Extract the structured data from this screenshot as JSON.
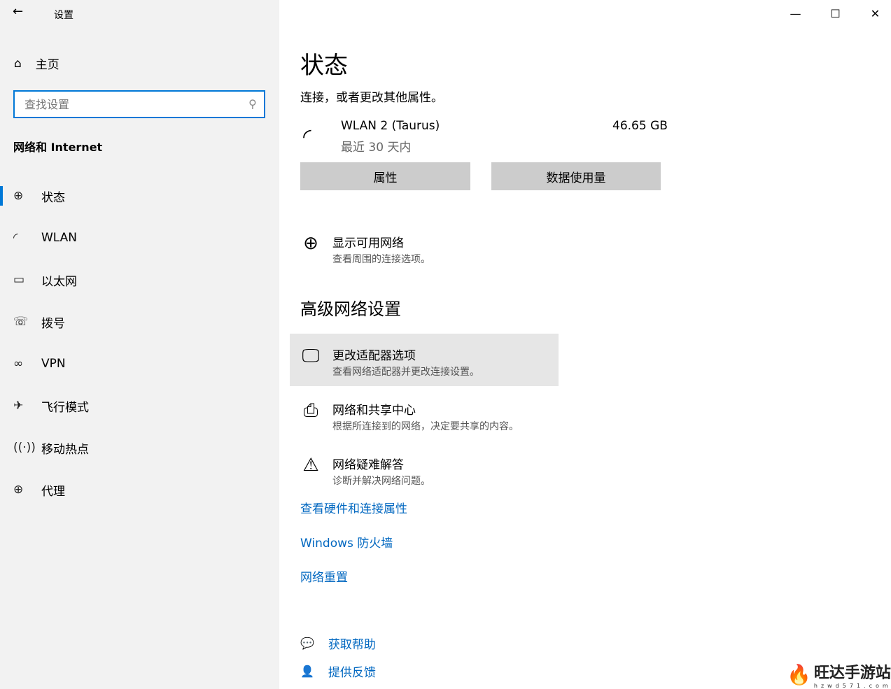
{
  "app": {
    "title": "设置",
    "back_icon": "back-arrow-icon"
  },
  "sidebar": {
    "home": "主页",
    "search_placeholder": "查找设置",
    "section": "网络和 Internet",
    "items": [
      {
        "label": "状态",
        "icon": "🌐",
        "active": true
      },
      {
        "label": "WLAN",
        "icon": "wifi"
      },
      {
        "label": "以太网",
        "icon": "ethernet"
      },
      {
        "label": "拨号",
        "icon": "dialup"
      },
      {
        "label": "VPN",
        "icon": "vpn"
      },
      {
        "label": "飞行模式",
        "icon": "airplane"
      },
      {
        "label": "移动热点",
        "icon": "hotspot"
      },
      {
        "label": "代理",
        "icon": "globe"
      }
    ]
  },
  "main": {
    "title": "状态",
    "description": "连接，或者更改其他属性。",
    "network": {
      "name": "WLAN 2 (Taurus)",
      "period": "最近 30 天内",
      "usage": "46.65 GB"
    },
    "buttons": {
      "properties": "属性",
      "data_usage": "数据使用量"
    },
    "show_networks": {
      "title": "显示可用网络",
      "sub": "查看周围的连接选项。"
    },
    "advanced_title": "高级网络设置",
    "advanced": [
      {
        "title": "更改适配器选项",
        "sub": "查看网络适配器并更改连接设置。"
      },
      {
        "title": "网络和共享中心",
        "sub": "根据所连接到的网络，决定要共享的内容。"
      },
      {
        "title": "网络疑难解答",
        "sub": "诊断并解决网络问题。"
      }
    ],
    "links": [
      "查看硬件和连接属性",
      "Windows 防火墙",
      "网络重置"
    ],
    "help": "获取帮助",
    "feedback": "提供反馈"
  },
  "watermark": {
    "text": "旺达手游站",
    "sub": "hzwd571.com"
  },
  "colors": {
    "accent": "#0078d7",
    "link": "#0067c0"
  }
}
